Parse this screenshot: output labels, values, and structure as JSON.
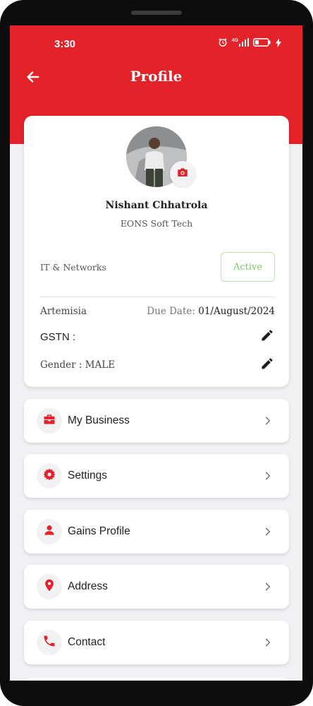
{
  "status_bar": {
    "time": "3:30",
    "network": "4G"
  },
  "header": {
    "title": "Profile"
  },
  "profile": {
    "name": "Nishant Chhatrola",
    "company": "EONS Soft Tech",
    "category": "IT & Networks",
    "status": "Active",
    "org": "Artemisia",
    "due_label": "Due Date: ",
    "due_date": "01/August/2024",
    "gstn_label": "GSTN :",
    "gender_label": "Gender : MALE"
  },
  "menu": [
    {
      "label": "My Business",
      "icon": "briefcase-icon"
    },
    {
      "label": "Settings",
      "icon": "gear-icon"
    },
    {
      "label": "Gains Profile",
      "icon": "person-icon"
    },
    {
      "label": "Address",
      "icon": "location-pin-icon"
    },
    {
      "label": "Contact",
      "icon": "phone-icon"
    }
  ],
  "colors": {
    "brand_red": "#e42229",
    "active_green": "#7cc965",
    "background": "#f1f1f4"
  }
}
